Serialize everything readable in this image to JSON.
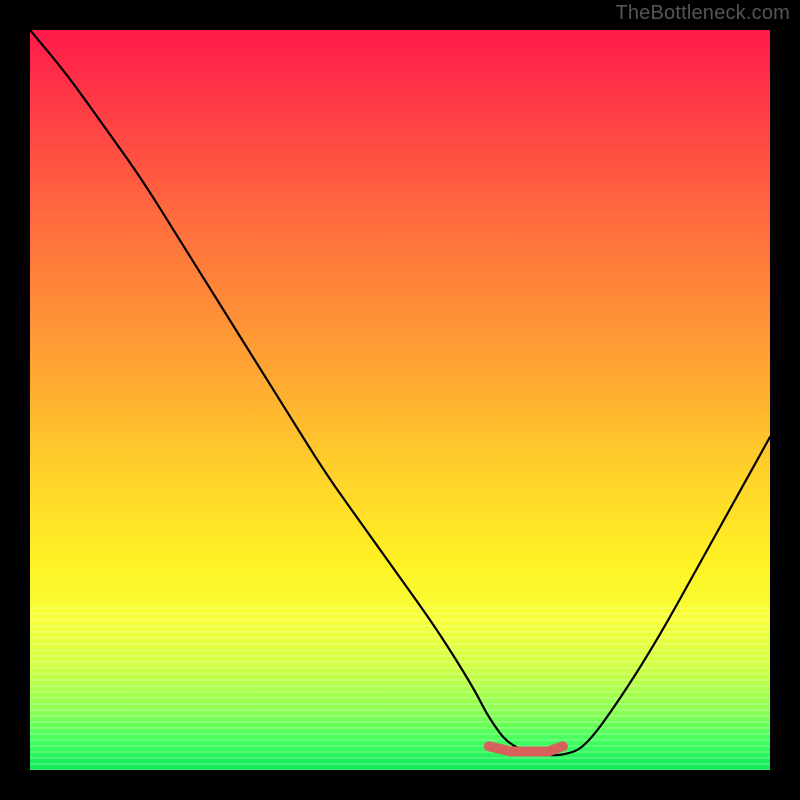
{
  "watermark": "TheBottleneck.com",
  "colors": {
    "background": "#000000",
    "curve": "#000000",
    "highlight": "#d9615b",
    "gradient_top": "#ff1a4a",
    "gradient_mid": "#fff224",
    "gradient_bottom": "#10e85a"
  },
  "chart_data": {
    "type": "line",
    "title": "",
    "xlabel": "",
    "ylabel": "",
    "xlim": [
      0,
      100
    ],
    "ylim": [
      0,
      100
    ],
    "grid": false,
    "legend": false,
    "series": [
      {
        "name": "bottleneck-curve",
        "x": [
          0,
          5,
          10,
          15,
          20,
          25,
          30,
          35,
          40,
          45,
          50,
          55,
          60,
          62,
          65,
          70,
          72,
          75,
          80,
          85,
          90,
          95,
          100
        ],
        "y": [
          100,
          94,
          87,
          80,
          72,
          64,
          56,
          48,
          40,
          33,
          26,
          19,
          11,
          7,
          3,
          2,
          2,
          3,
          10,
          18,
          27,
          36,
          45
        ]
      },
      {
        "name": "optimal-range-highlight",
        "x": [
          62,
          65,
          70,
          72
        ],
        "y": [
          3.2,
          2.5,
          2.5,
          3.2
        ]
      }
    ],
    "annotations": []
  }
}
